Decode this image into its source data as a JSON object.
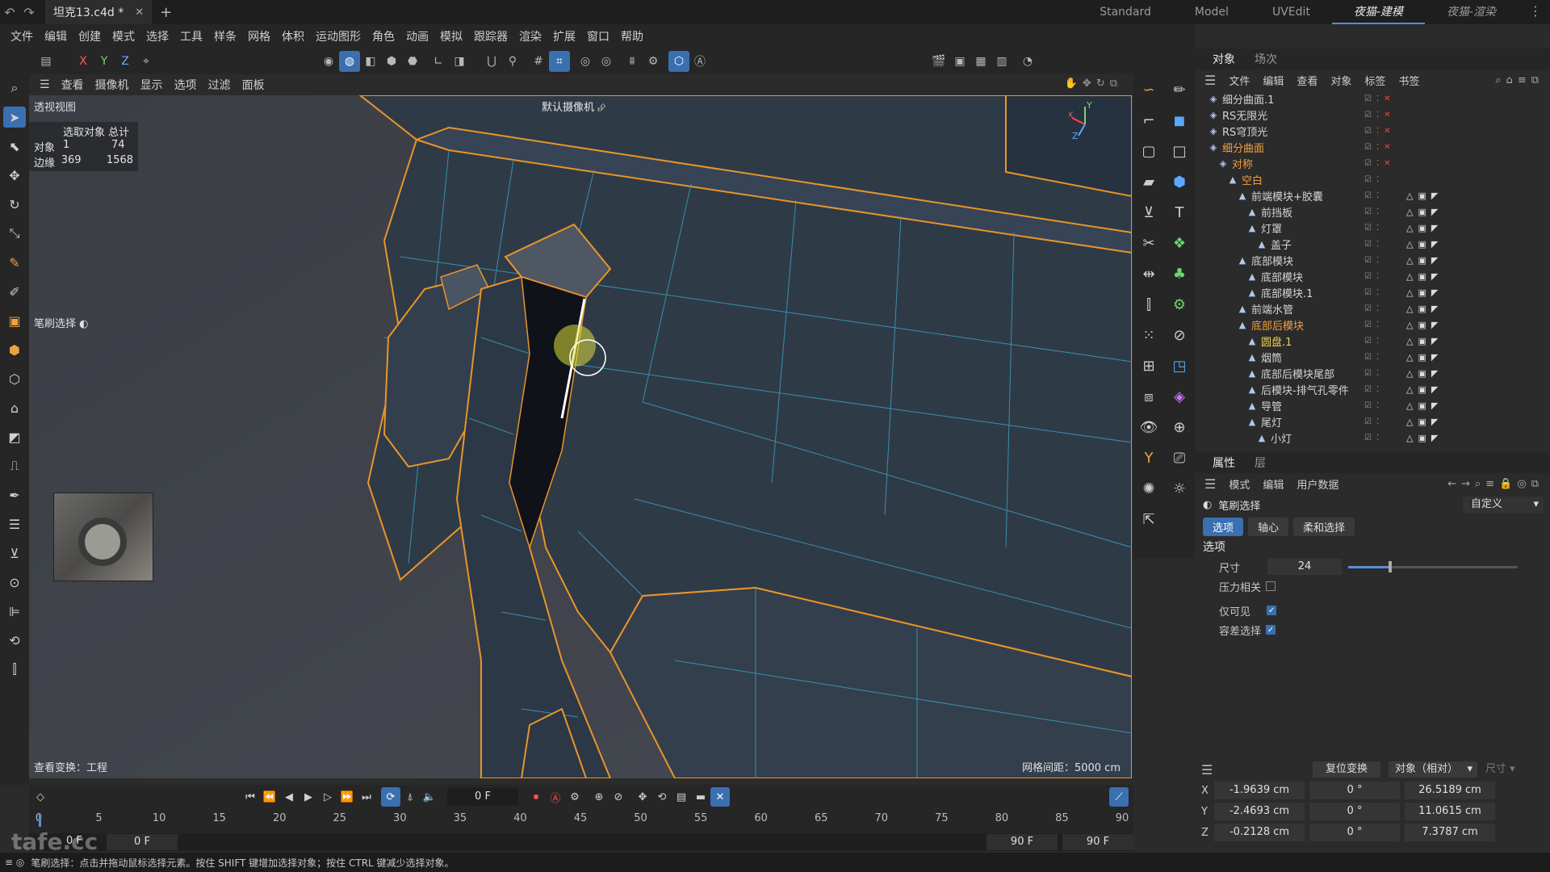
{
  "titlebar": {
    "doc_tab": "坦克13.c4d *",
    "layouts": [
      "Standard",
      "Model",
      "UVEdit",
      "夜猫-建模",
      "夜猫-渲染"
    ],
    "active_layout": "夜猫-建模"
  },
  "menu": [
    "文件",
    "编辑",
    "创建",
    "模式",
    "选择",
    "工具",
    "样条",
    "网格",
    "体积",
    "运动图形",
    "角色",
    "动画",
    "模拟",
    "跟踪器",
    "渲染",
    "扩展",
    "窗口",
    "帮助"
  ],
  "toolbar": {
    "axis_x": "X",
    "axis_y": "Y",
    "axis_z": "Z"
  },
  "viewport": {
    "menu": [
      "查看",
      "摄像机",
      "显示",
      "选项",
      "过滤",
      "面板"
    ],
    "title": "透视视图",
    "camera": "默认摄像机",
    "stats": {
      "header": "选取对象 总计",
      "rows": [
        {
          "label": "对象",
          "selected": "1",
          "total": "74"
        },
        {
          "label": "边缘",
          "selected": "369",
          "total": "1568"
        }
      ]
    },
    "brush_label": "笔刷选择",
    "view_transform": "查看变换：工程",
    "grid_spacing": "网格间距：5000 cm"
  },
  "object_manager": {
    "tabs": [
      "对象",
      "场次"
    ],
    "menu": [
      "文件",
      "编辑",
      "查看",
      "对象",
      "标签",
      "书签"
    ],
    "items": [
      {
        "name": "细分曲面.1",
        "depth": 0,
        "color": "normal",
        "x": true
      },
      {
        "name": "RS无限光",
        "depth": 0,
        "color": "normal",
        "x": true
      },
      {
        "name": "RS穹顶光",
        "depth": 0,
        "color": "normal",
        "x": true
      },
      {
        "name": "细分曲面",
        "depth": 0,
        "color": "orange",
        "x": true
      },
      {
        "name": "对称",
        "depth": 1,
        "color": "orange",
        "x": true
      },
      {
        "name": "空白",
        "depth": 2,
        "color": "orange",
        "x": false
      },
      {
        "name": "前端模块+胶囊",
        "depth": 3,
        "color": "normal",
        "x": false
      },
      {
        "name": "前挡板",
        "depth": 4,
        "color": "normal",
        "x": false
      },
      {
        "name": "灯罩",
        "depth": 4,
        "color": "normal",
        "x": false
      },
      {
        "name": "盖子",
        "depth": 5,
        "color": "normal",
        "x": false
      },
      {
        "name": "底部模块",
        "depth": 3,
        "color": "normal",
        "x": false
      },
      {
        "name": "底部模块",
        "depth": 4,
        "color": "normal",
        "x": false
      },
      {
        "name": "底部模块.1",
        "depth": 4,
        "color": "normal",
        "x": false
      },
      {
        "name": "前端水管",
        "depth": 3,
        "color": "normal",
        "x": false
      },
      {
        "name": "底部后模块",
        "depth": 3,
        "color": "orange",
        "x": false
      },
      {
        "name": "圆盘.1",
        "depth": 4,
        "color": "yellow",
        "x": false
      },
      {
        "name": "烟筒",
        "depth": 4,
        "color": "normal",
        "x": false
      },
      {
        "name": "底部后模块尾部",
        "depth": 4,
        "color": "normal",
        "x": false
      },
      {
        "name": "后模块-排气孔零件",
        "depth": 4,
        "color": "normal",
        "x": false
      },
      {
        "name": "导管",
        "depth": 4,
        "color": "normal",
        "x": false
      },
      {
        "name": "尾灯",
        "depth": 4,
        "color": "normal",
        "x": false
      },
      {
        "name": "小灯",
        "depth": 5,
        "color": "normal",
        "x": false
      }
    ]
  },
  "attributes": {
    "tabs": [
      "属性",
      "层"
    ],
    "menu": [
      "模式",
      "编辑",
      "用户数据"
    ],
    "title": "笔刷选择",
    "preset": "自定义",
    "sub_tabs": [
      "选项",
      "轴心",
      "柔和选择"
    ],
    "section": "选项",
    "size_label": "尺寸",
    "size_value": "24",
    "size_slider": 0.24,
    "pressure_label": "压力相关",
    "visible_only_label": "仅可见",
    "tolerance_label": "容差选择"
  },
  "coordinates": {
    "reset_label": "复位变换",
    "mode": "对象（相对）",
    "size_label": "尺寸",
    "rows": [
      {
        "axis": "X",
        "pos": "-1.9639 cm",
        "rot": "0 °",
        "size": "26.5189 cm"
      },
      {
        "axis": "Y",
        "pos": "-2.4693 cm",
        "rot": "0 °",
        "size": "11.0615 cm"
      },
      {
        "axis": "Z",
        "pos": "-0.2128 cm",
        "rot": "0 °",
        "size": "7.3787 cm"
      }
    ]
  },
  "timeline": {
    "current_frame": "0 F",
    "ticks": [
      "0",
      "5",
      "10",
      "15",
      "20",
      "25",
      "30",
      "35",
      "40",
      "45",
      "50",
      "55",
      "60",
      "65",
      "70",
      "75",
      "80",
      "85",
      "90"
    ],
    "range_start": "0 F",
    "range_start2": "0 F",
    "range_end": "90 F",
    "range_end2": "90 F"
  },
  "status": "笔刷选择：点击并拖动鼠标选择元素。按住 SHIFT 键增加选择对象；按住 CTRL 键减少选择对象。",
  "watermark": "tafe.cc"
}
